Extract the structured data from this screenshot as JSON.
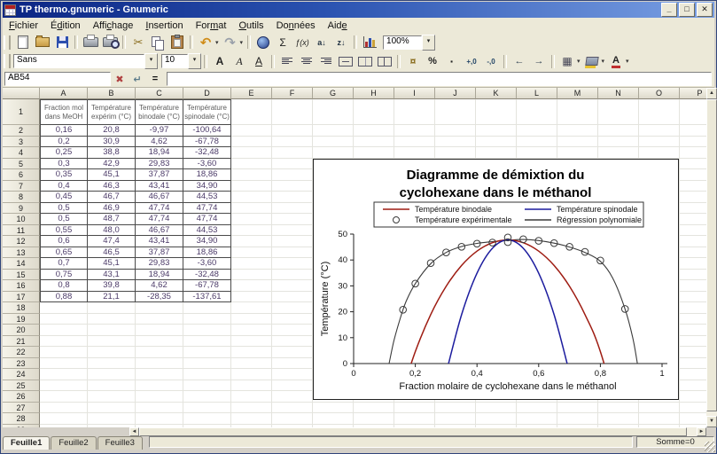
{
  "window": {
    "title": "TP thermo.gnumeric - Gnumeric",
    "buttons": {
      "minimize": "_",
      "maximize": "□",
      "close": "✕"
    }
  },
  "menu": {
    "items": [
      {
        "label": "Fichier",
        "accel": 0
      },
      {
        "label": "Édition",
        "accel": 1
      },
      {
        "label": "Affichage",
        "accel": 4
      },
      {
        "label": "Insertion",
        "accel": 0
      },
      {
        "label": "Format",
        "accel": 3
      },
      {
        "label": "Outils",
        "accel": 0
      },
      {
        "label": "Données",
        "accel": 2
      },
      {
        "label": "Aide",
        "accel": 3
      }
    ]
  },
  "toolbar_main": {
    "zoom_value": "100%",
    "items": [
      {
        "name": "new-file",
        "glyph": ""
      },
      {
        "name": "open-folder",
        "glyph": ""
      },
      {
        "name": "save",
        "glyph": ""
      },
      {
        "sep": true
      },
      {
        "name": "print",
        "glyph": ""
      },
      {
        "name": "print-preview",
        "glyph": ""
      },
      {
        "sep": true
      },
      {
        "name": "cut",
        "glyph": "✂"
      },
      {
        "name": "copy",
        "glyph": ""
      },
      {
        "name": "paste",
        "glyph": ""
      },
      {
        "sep": true
      },
      {
        "name": "undo",
        "glyph": "↶",
        "drop": true
      },
      {
        "name": "redo",
        "glyph": "↷",
        "drop": true
      },
      {
        "sep": true
      },
      {
        "name": "hyperlink",
        "glyph": ""
      },
      {
        "name": "sum",
        "glyph": "Σ"
      },
      {
        "name": "function",
        "glyph": "ƒ(x)"
      },
      {
        "name": "sort-az",
        "glyph": "a↓"
      },
      {
        "name": "sort-za",
        "glyph": "z↓"
      },
      {
        "sep": true
      },
      {
        "name": "chart",
        "glyph": ""
      }
    ]
  },
  "toolbar_format": {
    "font_name": "Sans",
    "font_size": "10",
    "items": [
      {
        "name": "bold",
        "glyph": "A"
      },
      {
        "name": "italic",
        "glyph": "A"
      },
      {
        "name": "underline",
        "glyph": "A"
      },
      {
        "sep": true
      },
      {
        "name": "align-left",
        "glyph": ""
      },
      {
        "name": "align-center",
        "glyph": ""
      },
      {
        "name": "align-right",
        "glyph": ""
      },
      {
        "name": "center-across",
        "glyph": ""
      },
      {
        "name": "merge-cells",
        "glyph": ""
      },
      {
        "name": "unmerge-cells",
        "glyph": ""
      },
      {
        "sep": true
      },
      {
        "name": "format-money",
        "glyph": "¤"
      },
      {
        "name": "format-percent",
        "glyph": "%"
      },
      {
        "name": "format-thousands",
        "glyph": "·"
      },
      {
        "name": "increase-precision",
        "glyph": "+,0"
      },
      {
        "name": "decrease-precision",
        "glyph": "-,0"
      },
      {
        "sep": true
      },
      {
        "name": "decrease-indent",
        "glyph": "←"
      },
      {
        "name": "increase-indent",
        "glyph": "→"
      },
      {
        "sep": true
      },
      {
        "name": "borders",
        "glyph": "▦",
        "drop": true
      },
      {
        "name": "background-color",
        "glyph": "",
        "drop": true
      },
      {
        "name": "font-color",
        "glyph": "A",
        "drop": true
      }
    ]
  },
  "formula_bar": {
    "cell_ref": "AB54",
    "cancel": "✖",
    "enter": "↵",
    "equals": "=",
    "formula": ""
  },
  "sheet": {
    "columns": [
      "A",
      "B",
      "C",
      "D",
      "E",
      "F",
      "G",
      "H",
      "I",
      "J",
      "K",
      "L",
      "M",
      "N",
      "O",
      "P"
    ],
    "row_count": 29,
    "table": {
      "headers": [
        "Fraction mol\ndans MeOH",
        "Température\nexpérim (°C)",
        "Température\nbinodale (°C)",
        "Température\nspinodale (°C)"
      ],
      "rows": [
        [
          "0,16",
          "20,8",
          "-9,97",
          "-100,64"
        ],
        [
          "0,2",
          "30,9",
          "4,62",
          "-67,78"
        ],
        [
          "0,25",
          "38,8",
          "18,94",
          "-32,48"
        ],
        [
          "0,3",
          "42,9",
          "29,83",
          "-3,60"
        ],
        [
          "0,35",
          "45,1",
          "37,87",
          "18,86"
        ],
        [
          "0,4",
          "46,3",
          "43,41",
          "34,90"
        ],
        [
          "0,45",
          "46,7",
          "46,67",
          "44,53"
        ],
        [
          "0,5",
          "46,9",
          "47,74",
          "47,74"
        ],
        [
          "0,5",
          "48,7",
          "47,74",
          "47,74"
        ],
        [
          "0,55",
          "48,0",
          "46,67",
          "44,53"
        ],
        [
          "0,6",
          "47,4",
          "43,41",
          "34,90"
        ],
        [
          "0,65",
          "46,5",
          "37,87",
          "18,86"
        ],
        [
          "0,7",
          "45,1",
          "29,83",
          "-3,60"
        ],
        [
          "0,75",
          "43,1",
          "18,94",
          "-32,48"
        ],
        [
          "0,8",
          "39,8",
          "4,62",
          "-67,78"
        ],
        [
          "0,88",
          "21,1",
          "-28,35",
          "-137,61"
        ]
      ]
    }
  },
  "chart_data": {
    "type": "line",
    "title_lines": [
      "Diagramme de démixtion du",
      "cyclohexane dans le méthanol"
    ],
    "xlabel": "Fraction molaire de cyclohexane dans le méthanol",
    "ylabel": "Température (°C)",
    "xlim": [
      0,
      1
    ],
    "ylim": [
      0,
      50
    ],
    "xticks": {
      "values": [
        0,
        0.2,
        0.4,
        0.6,
        0.8,
        1
      ],
      "labels": [
        "0",
        "0,2",
        "0,4",
        "0,6",
        "0,8",
        "1"
      ]
    },
    "yticks": {
      "values": [
        0,
        10,
        20,
        30,
        40,
        50
      ],
      "labels": [
        "0",
        "10",
        "20",
        "30",
        "40",
        "50"
      ]
    },
    "grid": false,
    "legend_position": "top",
    "legend": [
      {
        "label": "Température binodale",
        "kind": "line",
        "color": "#9e1c12"
      },
      {
        "label": "Température expérimentale",
        "kind": "circle",
        "color": "#3a3a3a"
      },
      {
        "label": "Température spinodale",
        "kind": "line",
        "color": "#1c1c9e"
      },
      {
        "label": "Régression polynomiale",
        "kind": "line",
        "color": "#3a3a3a"
      }
    ],
    "series": [
      {
        "name": "Régression polynomiale",
        "type": "line",
        "color": "#3a3a3a",
        "width": 1.1,
        "x": [
          0.115,
          0.13,
          0.15,
          0.17,
          0.2,
          0.25,
          0.3,
          0.35,
          0.4,
          0.45,
          0.5,
          0.55,
          0.6,
          0.65,
          0.7,
          0.75,
          0.8,
          0.84,
          0.88,
          0.905,
          0.92
        ],
        "y": [
          0,
          8.5,
          17,
          24,
          30.9,
          38.6,
          42.9,
          45.2,
          46.4,
          47.1,
          47.6,
          47.9,
          47.5,
          46.5,
          45.0,
          42.9,
          39.5,
          33.0,
          21.1,
          10,
          0
        ]
      },
      {
        "name": "Température binodale",
        "type": "line",
        "color": "#9e1c12",
        "width": 1.5,
        "x": [
          0.16,
          0.2,
          0.25,
          0.3,
          0.35,
          0.4,
          0.45,
          0.5,
          0.55,
          0.6,
          0.65,
          0.7,
          0.75,
          0.8,
          0.88
        ],
        "y": [
          -9.97,
          4.62,
          18.94,
          29.83,
          37.87,
          43.41,
          46.67,
          47.74,
          46.67,
          43.41,
          37.87,
          29.83,
          18.94,
          4.62,
          -28.35
        ]
      },
      {
        "name": "Température spinodale",
        "type": "line",
        "color": "#1c1c9e",
        "width": 1.5,
        "x": [
          0.3,
          0.35,
          0.4,
          0.45,
          0.5,
          0.55,
          0.6,
          0.65,
          0.7
        ],
        "y": [
          -3.6,
          18.86,
          34.9,
          44.53,
          47.74,
          44.53,
          34.9,
          18.86,
          -3.6
        ]
      },
      {
        "name": "Température expérimentale",
        "type": "scatter",
        "color": "#3a3a3a",
        "x": [
          0.16,
          0.2,
          0.25,
          0.3,
          0.35,
          0.4,
          0.45,
          0.5,
          0.5,
          0.55,
          0.6,
          0.65,
          0.7,
          0.75,
          0.8,
          0.88
        ],
        "y": [
          20.8,
          30.9,
          38.8,
          42.9,
          45.1,
          46.3,
          46.7,
          46.9,
          48.7,
          48.0,
          47.4,
          46.5,
          45.1,
          43.1,
          39.8,
          21.1
        ]
      }
    ]
  },
  "tabs": [
    "Feuille1",
    "Feuille2",
    "Feuille3"
  ],
  "status_bar": {
    "somme": "Somme=0"
  },
  "scroll": {
    "up": "▲",
    "down": "▼",
    "left": "◄",
    "right": "►"
  }
}
